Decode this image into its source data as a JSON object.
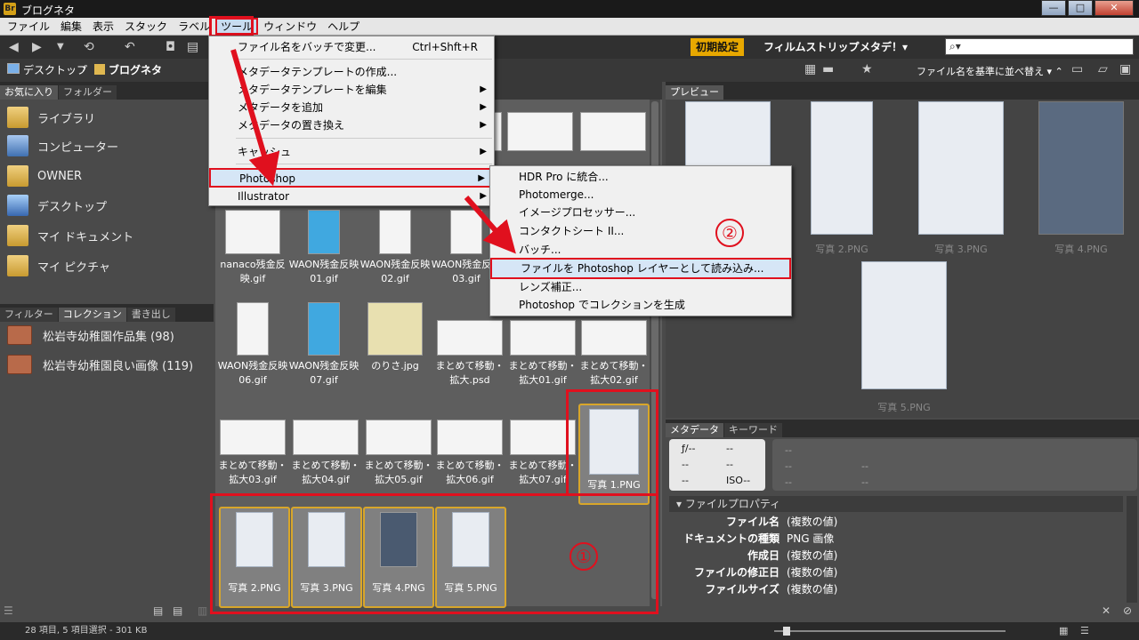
{
  "window": {
    "app_badge": "Br",
    "title": "ブログネタ",
    "minimize": "—",
    "maximize": "□",
    "close": "✕"
  },
  "menubar": [
    "ファイル",
    "編集",
    "表示",
    "スタック",
    "ラベル",
    "ツール",
    "ウィンドウ",
    "ヘルプ"
  ],
  "workspaces": {
    "essentials": "初期設定",
    "filmstrip": "フィルムストリップ",
    "metadata": "メタデ！▾"
  },
  "search": {
    "placeholder": "⌕▾"
  },
  "path": {
    "desktop": "デスクトップ",
    "sep": "›",
    "folder": "ブログネタ"
  },
  "sort_label": "ファイル名を基準に並べ替え ▾ ⌃",
  "left": {
    "tabs": [
      "お気に入り",
      "フォルダー"
    ],
    "favorites": [
      "ライブラリ",
      "コンピューター",
      "OWNER",
      "デスクトップ",
      "マイ ドキュメント",
      "マイ ピクチャ"
    ],
    "bottom_tabs": [
      "フィルター",
      "コレクション",
      "書き出し"
    ],
    "collections": [
      "松岩寺幼稚園作品集 (98)",
      "松岩寺幼稚園良い画像 (119)"
    ]
  },
  "thumbs": {
    "row2": [
      "nanaco残金反映.gif",
      "WAON残金反映01.gif",
      "WAON残金反映02.gif",
      "WAON残金反映03.gif"
    ],
    "row3": [
      "WAON残金反映06.gif",
      "WAON残金反映07.gif",
      "のりさ.jpg",
      "まとめて移動・拡大.psd",
      "まとめて移動・拡大01.gif",
      "まとめて移動・拡大02.gif"
    ],
    "row4": [
      "まとめて移動・拡大03.gif",
      "まとめて移動・拡大04.gif",
      "まとめて移動・拡大05.gif",
      "まとめて移動・拡大06.gif",
      "まとめて移動・拡大07.gif",
      "写真 1.PNG"
    ],
    "row5": [
      "写真 2.PNG",
      "写真 3.PNG",
      "写真 4.PNG",
      "写真 5.PNG"
    ]
  },
  "preview": {
    "tab": "プレビュー",
    "items": [
      "写真 2.PNG",
      "写真 3.PNG",
      "写真 4.PNG",
      "写真 5.PNG"
    ]
  },
  "metadata": {
    "tabs": [
      "メタデータ",
      "キーワード"
    ],
    "fstop": "ƒ/--",
    "iso": "ISO--",
    "dash": "--",
    "section": "ファイルプロパティ",
    "props": [
      {
        "k": "ファイル名",
        "v": "(複数の値)"
      },
      {
        "k": "ドキュメントの種類",
        "v": "PNG 画像"
      },
      {
        "k": "作成日",
        "v": "(複数の値)"
      },
      {
        "k": "ファイルの修正日",
        "v": "(複数の値)"
      },
      {
        "k": "ファイルサイズ",
        "v": "(複数の値)"
      }
    ]
  },
  "tools_menu": [
    "ファイル名をバッチで変更...",
    "メタデータテンプレートの作成...",
    "メタデータテンプレートを編集",
    "メタデータを追加",
    "メタデータの置き換え",
    "キャッシュ",
    "Photoshop",
    "Illustrator"
  ],
  "tools_shortcut": "Ctrl+Shft+R",
  "photoshop_menu": [
    "HDR Pro に統合...",
    "Photomerge...",
    "イメージプロセッサー...",
    "コンタクトシート II...",
    "バッチ...",
    "ファイルを Photoshop レイヤーとして読み込み...",
    "レンズ補正...",
    "Photoshop でコレクションを生成"
  ],
  "annotations": {
    "one": "①",
    "two": "②"
  },
  "status": "28 項目, 5 項目選択 - 301 KB"
}
